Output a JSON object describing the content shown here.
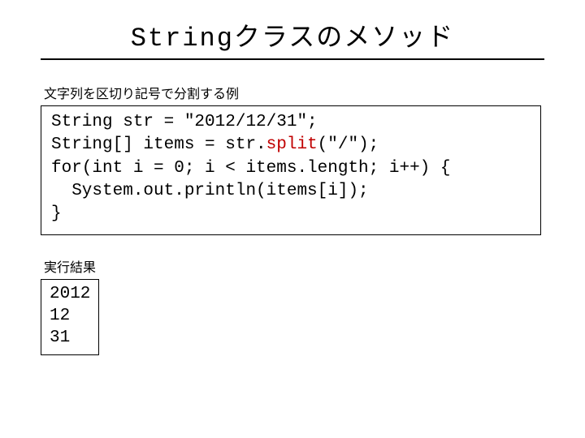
{
  "title": "Stringクラスのメソッド",
  "section1_label": "文字列を区切り記号で分割する例",
  "code": {
    "l1": "String str = \"2012/12/31\";",
    "l2a": "String[] items = str.",
    "l2b": "split",
    "l2c": "(\"/\");",
    "l3": "for(int i = 0; i < items.length; i++) {",
    "l4": "  System.out.println(items[i]);",
    "l5": "}"
  },
  "section2_label": "実行結果",
  "result": {
    "l1": "2012",
    "l2": "12",
    "l3": "31"
  }
}
